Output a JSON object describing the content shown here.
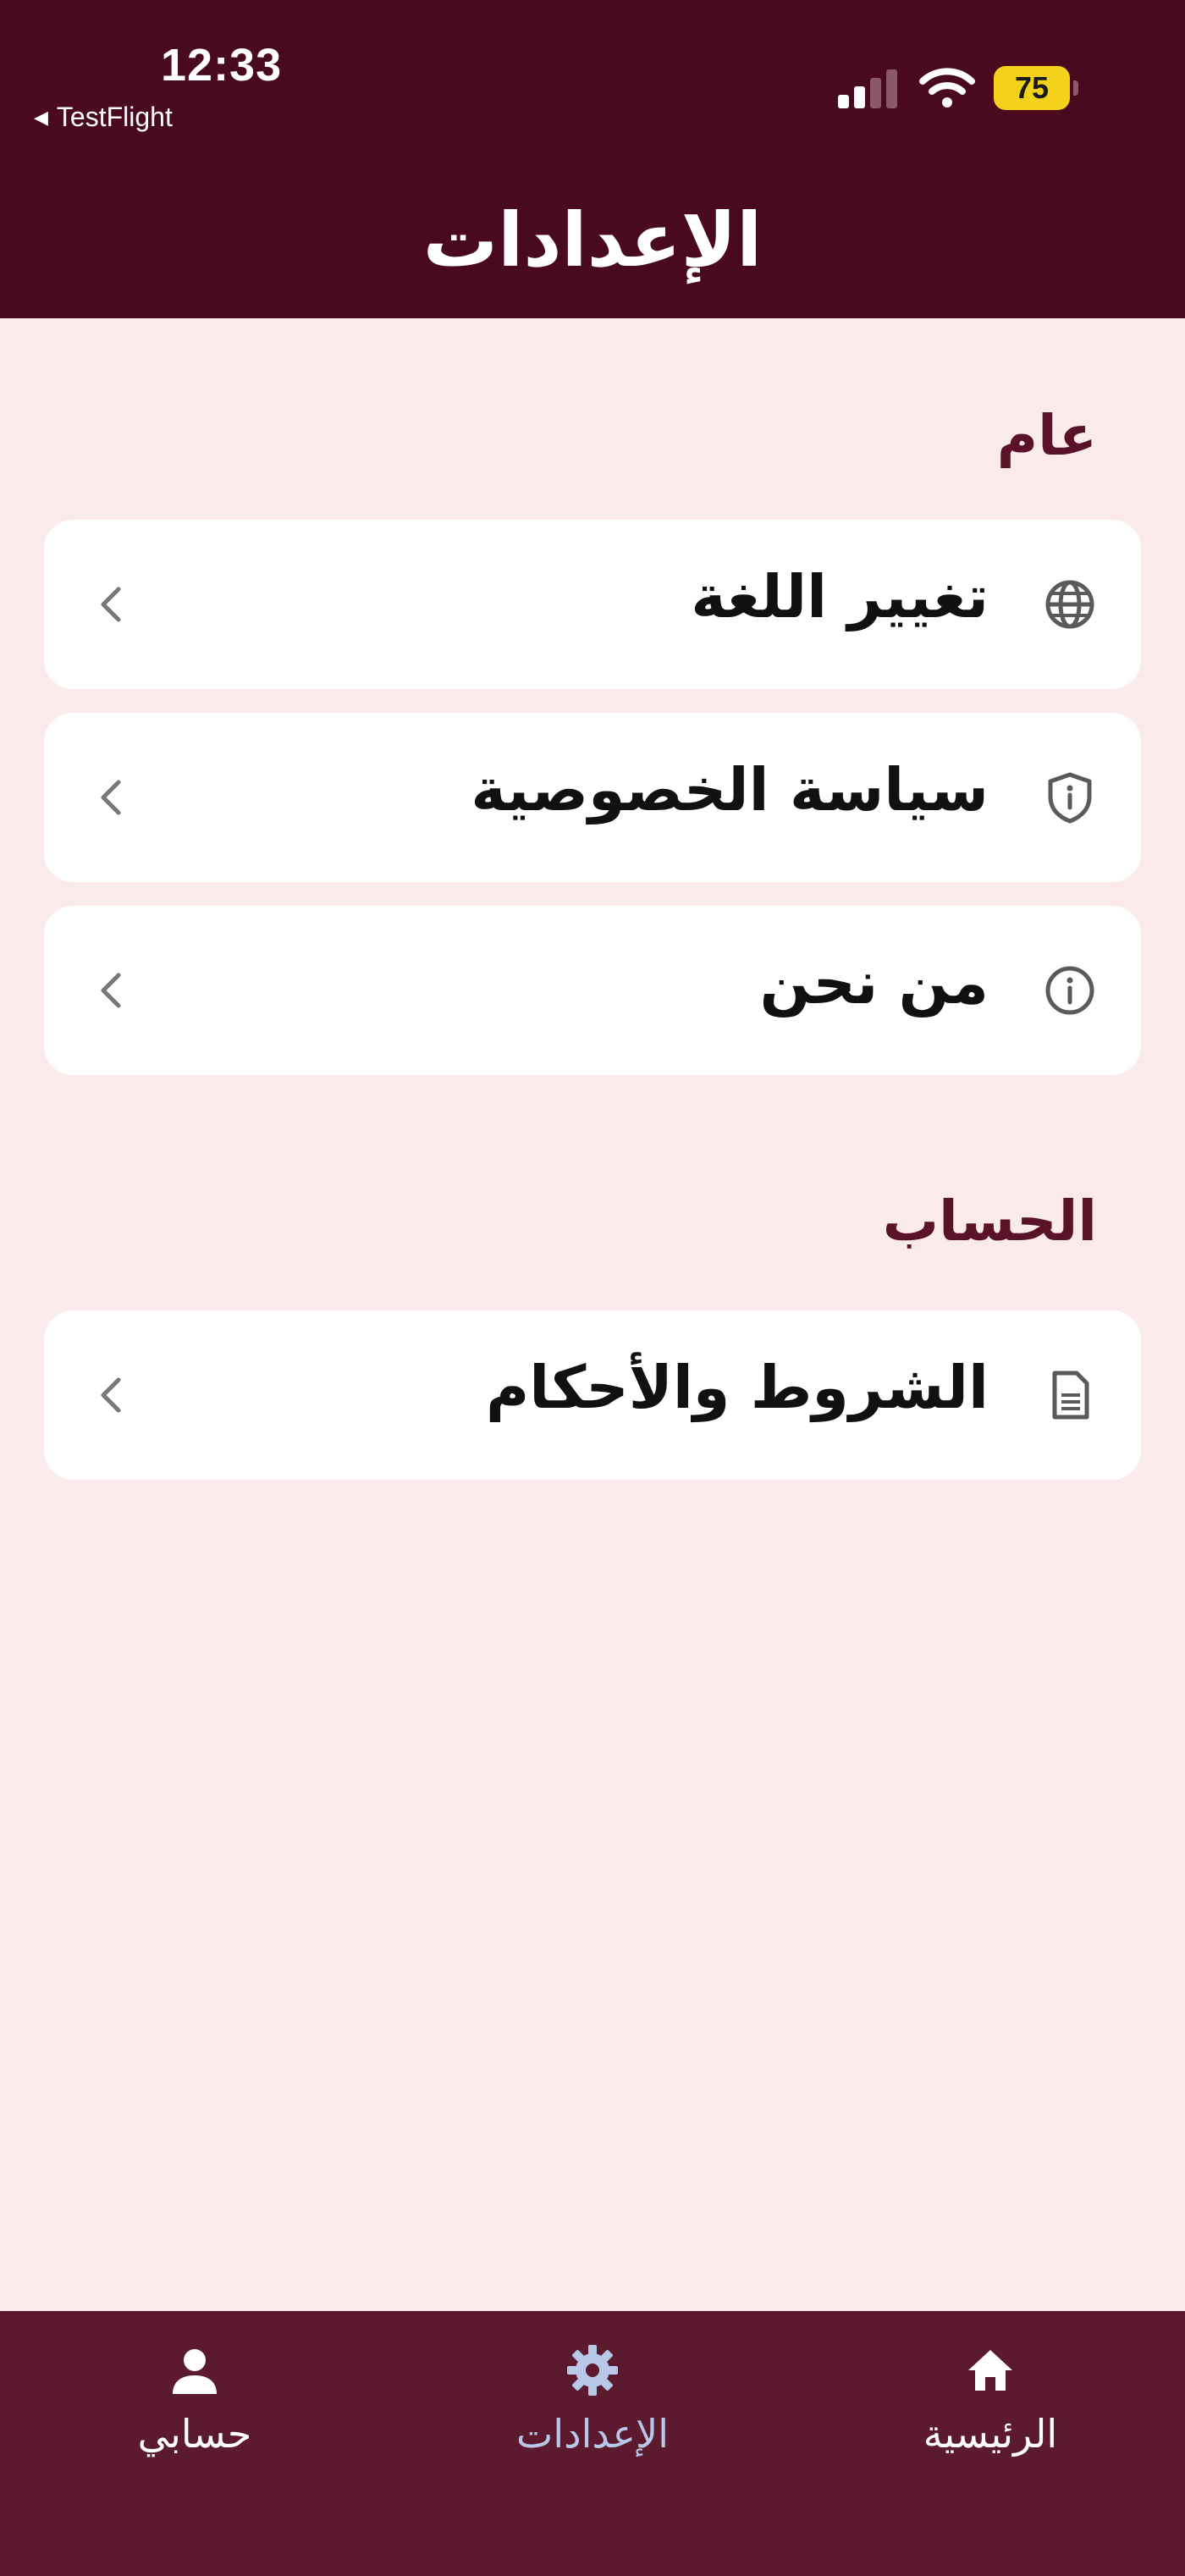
{
  "status_bar": {
    "time": "12:33",
    "back_app": "TestFlight",
    "battery": "75"
  },
  "header": {
    "title": "الإعدادات"
  },
  "sections": [
    {
      "title": "عام",
      "items": [
        {
          "label": "تغيير اللغة",
          "icon": "globe-icon"
        },
        {
          "label": "سياسة الخصوصية",
          "icon": "shield-info-icon"
        },
        {
          "label": "من نحن",
          "icon": "info-icon"
        }
      ]
    },
    {
      "title": "الحساب",
      "items": [
        {
          "label": "الشروط والأحكام",
          "icon": "document-icon"
        }
      ]
    }
  ],
  "tab_bar": {
    "active": "settings",
    "tabs": [
      {
        "id": "home",
        "label": "الرئيسية",
        "icon": "home-icon"
      },
      {
        "id": "settings",
        "label": "الإعدادات",
        "icon": "gear-icon"
      },
      {
        "id": "account",
        "label": "حسابي",
        "icon": "person-icon"
      }
    ]
  },
  "colors": {
    "header_bg": "#4a0a1e",
    "page_bg": "#fbeaec",
    "section_title": "#5a1228",
    "tabbar_bg": "#5b1a2d",
    "tab_active": "#b8c8e8",
    "battery": "#f2d21b"
  }
}
